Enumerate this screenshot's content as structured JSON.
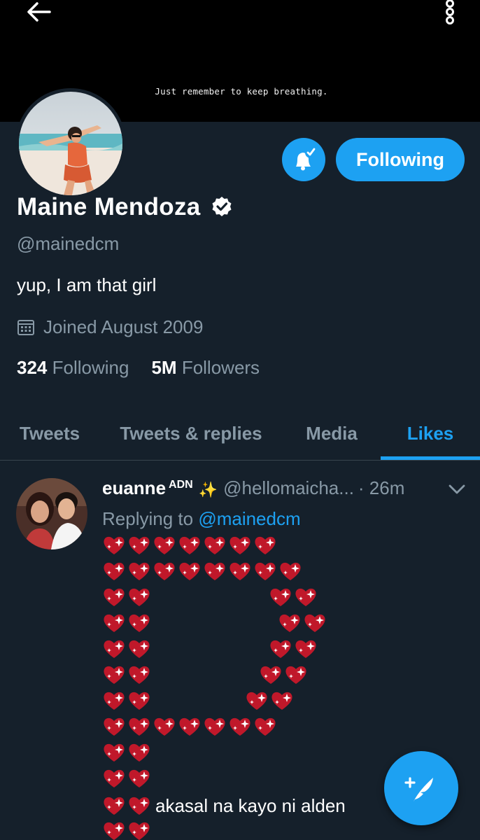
{
  "banner": {
    "text": "Just remember to keep breathing."
  },
  "toolbar": {
    "back_icon": "back-arrow-icon",
    "more_icon": "more-vertical-icon"
  },
  "profile": {
    "display_name": "Maine Mendoza",
    "handle": "@mainedcm",
    "bio": "yup, I am that girl",
    "joined": "Joined August 2009",
    "verified": true,
    "following_count": "324",
    "following_label": "Following",
    "followers_count": "5M",
    "followers_label": "Followers"
  },
  "actions": {
    "follow_label": "Following",
    "notifications_icon": "bell-check-icon"
  },
  "tabs": [
    {
      "label": "Tweets",
      "active": false
    },
    {
      "label": "Tweets & replies",
      "active": false
    },
    {
      "label": "Media",
      "active": false
    },
    {
      "label": "Likes",
      "active": true
    }
  ],
  "tweet": {
    "author_name": "euanne",
    "author_badge": "ADN",
    "author_emoji": "✨",
    "author_handle": "@hellomaicha...",
    "time": "· 26m",
    "replying_prefix": "Replying to",
    "replying_to": "@mainedcm",
    "emoji_art": "💖",
    "caption": "akasal na kayo ni alden"
  },
  "colors": {
    "background": "#15202b",
    "accent": "#1da1f2",
    "secondary_text": "#8899a6",
    "heart": "#c0182a"
  }
}
